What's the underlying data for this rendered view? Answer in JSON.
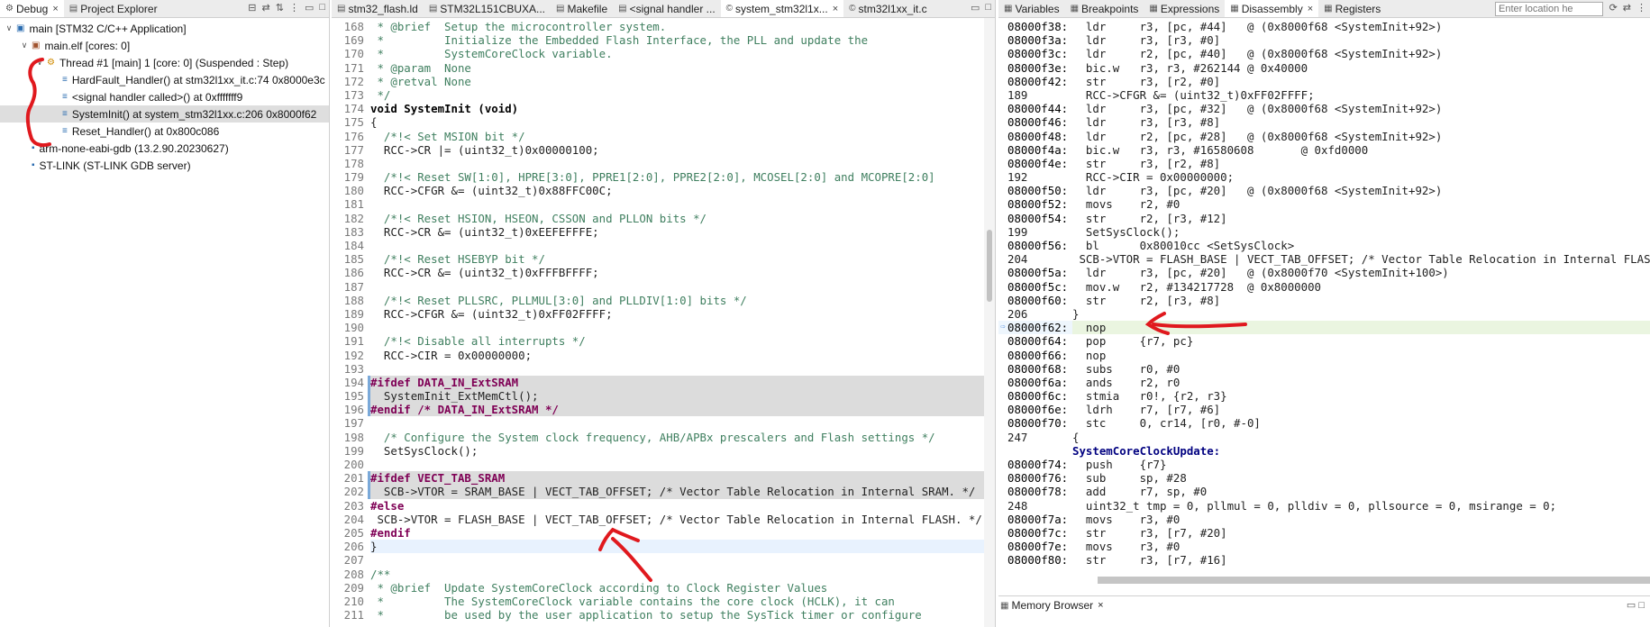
{
  "debug_panel": {
    "tabs": [
      {
        "label": "Debug",
        "icon": "debug-icon",
        "close": "×"
      },
      {
        "label": "Project Explorer",
        "icon": "folder-icon"
      }
    ],
    "tree": [
      {
        "label": "main [STM32 C/C++ Application]",
        "level": 0,
        "twisty": "∨",
        "icon": "c-app-icon"
      },
      {
        "label": "main.elf [cores: 0]",
        "level": 1,
        "twisty": "∨",
        "icon": "elf-icon"
      },
      {
        "label": "Thread #1 [main] 1 [core: 0] (Suspended : Step)",
        "level": 2,
        "twisty": "∨",
        "icon": "thread-icon"
      },
      {
        "label": "HardFault_Handler() at stm32l1xx_it.c:74 0x8000e3c",
        "level": 3,
        "twisty": "",
        "icon": "stack-frame-icon"
      },
      {
        "label": "<signal handler called>() at 0xfffffff9",
        "level": 3,
        "twisty": "",
        "icon": "stack-frame-icon"
      },
      {
        "label": "SystemInit() at system_stm32l1xx.c:206 0x8000f62",
        "level": 3,
        "twisty": "",
        "icon": "stack-frame-icon",
        "selected": true
      },
      {
        "label": "Reset_Handler() at 0x800c086",
        "level": 3,
        "twisty": "",
        "icon": "stack-frame-icon"
      },
      {
        "label": "arm-none-eabi-gdb (13.2.90.20230627)",
        "level": 1,
        "twisty": "",
        "icon": "gdb-icon"
      },
      {
        "label": "ST-LINK (ST-LINK GDB server)",
        "level": 1,
        "twisty": "",
        "icon": "stlink-icon"
      }
    ]
  },
  "editor": {
    "tabs": [
      {
        "label": "stm32_flash.ld",
        "icon": "file-icon"
      },
      {
        "label": "STM32L151CBUXA...",
        "icon": "file-icon"
      },
      {
        "label": "Makefile",
        "icon": "file-icon"
      },
      {
        "label": "<signal handler ...",
        "icon": "file-icon"
      },
      {
        "label": "system_stm32l1x...",
        "icon": "c-file-icon",
        "active": true,
        "close": "×"
      },
      {
        "label": "stm32l1xx_it.c",
        "icon": "c-file-icon"
      }
    ],
    "lines": [
      {
        "n": "168",
        "t": " * @brief  Setup the microcontroller system.",
        "k": "comment"
      },
      {
        "n": "169",
        "t": " *         Initialize the Embedded Flash Interface, the PLL and update the",
        "k": "comment"
      },
      {
        "n": "170",
        "t": " *         SystemCoreClock variable.",
        "k": "comment"
      },
      {
        "n": "171",
        "t": " * @param  None",
        "k": "comment"
      },
      {
        "n": "172",
        "t": " * @retval None",
        "k": "comment"
      },
      {
        "n": "173",
        "t": " */",
        "k": "comment"
      },
      {
        "n": "174",
        "t": "void SystemInit (void)",
        "k": "func"
      },
      {
        "n": "175",
        "t": "{",
        "k": "code"
      },
      {
        "n": "176",
        "t": "  /*!< Set MSION bit */",
        "k": "comment"
      },
      {
        "n": "177",
        "t": "  RCC->CR |= (uint32_t)0x00000100;",
        "k": "code"
      },
      {
        "n": "178",
        "t": "",
        "k": "code"
      },
      {
        "n": "179",
        "t": "  /*!< Reset SW[1:0], HPRE[3:0], PPRE1[2:0], PPRE2[2:0], MCOSEL[2:0] and MCOPRE[2:0]",
        "k": "comment"
      },
      {
        "n": "180",
        "t": "  RCC->CFGR &= (uint32_t)0x88FFC00C;",
        "k": "code"
      },
      {
        "n": "181",
        "t": "",
        "k": "code"
      },
      {
        "n": "182",
        "t": "  /*!< Reset HSION, HSEON, CSSON and PLLON bits */",
        "k": "comment"
      },
      {
        "n": "183",
        "t": "  RCC->CR &= (uint32_t)0xEEFEFFFE;",
        "k": "code"
      },
      {
        "n": "184",
        "t": "",
        "k": "code"
      },
      {
        "n": "185",
        "t": "  /*!< Reset HSEBYP bit */",
        "k": "comment"
      },
      {
        "n": "186",
        "t": "  RCC->CR &= (uint32_t)0xFFFBFFFF;",
        "k": "code"
      },
      {
        "n": "187",
        "t": "",
        "k": "code"
      },
      {
        "n": "188",
        "t": "  /*!< Reset PLLSRC, PLLMUL[3:0] and PLLDIV[1:0] bits */",
        "k": "comment"
      },
      {
        "n": "189",
        "t": "  RCC->CFGR &= (uint32_t)0xFF02FFFF;",
        "k": "code"
      },
      {
        "n": "190",
        "t": "",
        "k": "code"
      },
      {
        "n": "191",
        "t": "  /*!< Disable all interrupts */",
        "k": "comment"
      },
      {
        "n": "192",
        "t": "  RCC->CIR = 0x00000000;",
        "k": "code"
      },
      {
        "n": "193",
        "t": "",
        "k": "code"
      },
      {
        "n": "194",
        "t": "#ifdef DATA_IN_ExtSRAM",
        "k": "pre",
        "gray": true
      },
      {
        "n": "195",
        "t": "  SystemInit_ExtMemCtl();",
        "k": "code",
        "gray": true
      },
      {
        "n": "196",
        "t": "#endif /* DATA_IN_ExtSRAM */",
        "k": "pre",
        "gray": true
      },
      {
        "n": "197",
        "t": "",
        "k": "code"
      },
      {
        "n": "198",
        "t": "  /* Configure the System clock frequency, AHB/APBx prescalers and Flash settings */",
        "k": "comment"
      },
      {
        "n": "199",
        "t": "  SetSysClock();",
        "k": "code"
      },
      {
        "n": "200",
        "t": "",
        "k": "code"
      },
      {
        "n": "201",
        "t": "#ifdef VECT_TAB_SRAM",
        "k": "pre",
        "gray": true
      },
      {
        "n": "202",
        "t": "  SCB->VTOR = SRAM_BASE | VECT_TAB_OFFSET; /* Vector Table Relocation in Internal SRAM. */",
        "k": "code",
        "gray": true
      },
      {
        "n": "203",
        "t": "#else",
        "k": "pre"
      },
      {
        "n": "204",
        "t": " SCB->VTOR = FLASH_BASE | VECT_TAB_OFFSET; /* Vector Table Relocation in Internal FLASH. */",
        "k": "code"
      },
      {
        "n": "205",
        "t": "#endif",
        "k": "pre"
      },
      {
        "n": "206",
        "t": "}",
        "k": "code",
        "current": true
      },
      {
        "n": "207",
        "t": "",
        "k": "code"
      },
      {
        "n": "208",
        "t": "/**",
        "k": "comment"
      },
      {
        "n": "209",
        "t": " * @brief  Update SystemCoreClock according to Clock Register Values",
        "k": "comment"
      },
      {
        "n": "210",
        "t": " *         The SystemCoreClock variable contains the core clock (HCLK), it can",
        "k": "comment"
      },
      {
        "n": "211",
        "t": " *         be used by the user application to setup the SysTick timer or configure",
        "k": "comment"
      }
    ]
  },
  "right_panel": {
    "tabs": [
      {
        "label": "Variables",
        "icon": "variables-icon"
      },
      {
        "label": "Breakpoints",
        "icon": "breakpoints-icon"
      },
      {
        "label": "Expressions",
        "icon": "expressions-icon"
      },
      {
        "label": "Disassembly",
        "icon": "disassembly-icon",
        "active": true,
        "close": "×"
      },
      {
        "label": "Registers",
        "icon": "registers-icon"
      }
    ],
    "location_placeholder": "Enter location he",
    "lines": [
      {
        "a": "08000f38:",
        "i": "  ldr     r3, [pc, #44]   @ (0x8000f68 <SystemInit+92>)"
      },
      {
        "a": "08000f3a:",
        "i": "  ldr     r3, [r3, #0]"
      },
      {
        "a": "08000f3c:",
        "i": "  ldr     r2, [pc, #40]   @ (0x8000f68 <SystemInit+92>)"
      },
      {
        "a": "08000f3e:",
        "i": "  bic.w   r3, r3, #262144 @ 0x40000"
      },
      {
        "a": "08000f42:",
        "i": "  str     r3, [r2, #0]"
      },
      {
        "a": "189",
        "i": "  RCC->CFGR &= (uint32_t)0xFF02FFFF;",
        "src": true
      },
      {
        "a": "08000f44:",
        "i": "  ldr     r3, [pc, #32]   @ (0x8000f68 <SystemInit+92>)"
      },
      {
        "a": "08000f46:",
        "i": "  ldr     r3, [r3, #8]"
      },
      {
        "a": "08000f48:",
        "i": "  ldr     r2, [pc, #28]   @ (0x8000f68 <SystemInit+92>)"
      },
      {
        "a": "08000f4a:",
        "i": "  bic.w   r3, r3, #16580608       @ 0xfd0000"
      },
      {
        "a": "08000f4e:",
        "i": "  str     r3, [r2, #8]"
      },
      {
        "a": "192",
        "i": "  RCC->CIR = 0x00000000;",
        "src": true
      },
      {
        "a": "08000f50:",
        "i": "  ldr     r3, [pc, #20]   @ (0x8000f68 <SystemInit+92>)"
      },
      {
        "a": "08000f52:",
        "i": "  movs    r2, #0"
      },
      {
        "a": "08000f54:",
        "i": "  str     r2, [r3, #12]"
      },
      {
        "a": "199",
        "i": "  SetSysClock();",
        "src": true
      },
      {
        "a": "08000f56:",
        "i": "  bl      0x80010cc <SetSysClock>"
      },
      {
        "a": "204",
        "i": " SCB->VTOR = FLASH_BASE | VECT_TAB_OFFSET; /* Vector Table Relocation in Internal FLASH. */",
        "src": true
      },
      {
        "a": "08000f5a:",
        "i": "  ldr     r3, [pc, #20]   @ (0x8000f70 <SystemInit+100>)"
      },
      {
        "a": "08000f5c:",
        "i": "  mov.w   r2, #134217728  @ 0x8000000"
      },
      {
        "a": "08000f60:",
        "i": "  str     r2, [r3, #8]"
      },
      {
        "a": "206",
        "i": "}",
        "src": true
      },
      {
        "a": "08000f62:",
        "i": "  nop",
        "current": true
      },
      {
        "a": "08000f64:",
        "i": "  pop     {r7, pc}"
      },
      {
        "a": "08000f66:",
        "i": "  nop"
      },
      {
        "a": "08000f68:",
        "i": "  subs    r0, #0"
      },
      {
        "a": "08000f6a:",
        "i": "  ands    r2, r0"
      },
      {
        "a": "08000f6c:",
        "i": "  stmia   r0!, {r2, r3}"
      },
      {
        "a": "08000f6e:",
        "i": "  ldrh    r7, [r7, #6]"
      },
      {
        "a": "08000f70:",
        "i": "  stc     0, cr14, [r0, #-0]"
      },
      {
        "a": "247",
        "i": "{",
        "src": true
      },
      {
        "a": "",
        "i": "SystemCoreClockUpdate:",
        "func": true
      },
      {
        "a": "08000f74:",
        "i": "  push    {r7}"
      },
      {
        "a": "08000f76:",
        "i": "  sub     sp, #28"
      },
      {
        "a": "08000f78:",
        "i": "  add     r7, sp, #0"
      },
      {
        "a": "248",
        "i": "  uint32_t tmp = 0, pllmul = 0, plldiv = 0, pllsource = 0, msirange = 0;",
        "src": true
      },
      {
        "a": "08000f7a:",
        "i": "  movs    r3, #0"
      },
      {
        "a": "08000f7c:",
        "i": "  str     r3, [r7, #20]"
      },
      {
        "a": "08000f7e:",
        "i": "  movs    r3, #0"
      },
      {
        "a": "08000f80:",
        "i": "  str     r3, [r7, #16]"
      }
    ],
    "memory_browser": {
      "label": "Memory Browser",
      "icon": "memory-icon",
      "close": "×"
    }
  },
  "annotations": {
    "color": "#e0191e"
  }
}
